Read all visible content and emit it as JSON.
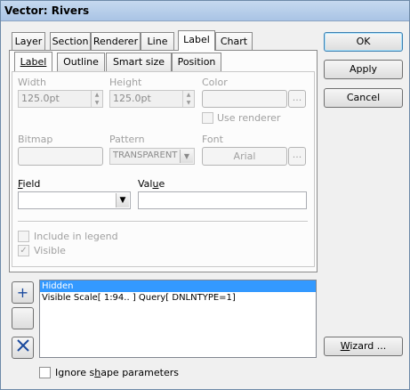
{
  "window": {
    "title": "Vector: Rivers"
  },
  "tabs": [
    "Layer",
    "Section",
    "Renderer",
    "Line",
    "Label",
    "Chart"
  ],
  "active_tab": "Label",
  "subtabs": [
    "Label",
    "Outline",
    "Smart size",
    "Position"
  ],
  "active_subtab": "Label",
  "fields": {
    "width_label": "Width",
    "width_value": "125.0pt",
    "height_label": "Height",
    "height_value": "125.0pt",
    "color_label": "Color",
    "color_btn": "...",
    "use_renderer_label": "Use renderer",
    "bitmap_label": "Bitmap",
    "pattern_label": "Pattern",
    "pattern_value": "TRANSPARENT",
    "font_label": "Font",
    "font_value": "Arial",
    "font_btn": "...",
    "field_label": "Field",
    "field_value": "",
    "value_label": "Value",
    "value_value": "",
    "include_in_legend_label": "Include in legend",
    "visible_label": "Visible"
  },
  "buttons": {
    "ok": "OK",
    "apply": "Apply",
    "cancel": "Cancel",
    "wizard": "Wizard ...",
    "add": "+"
  },
  "rules_list": [
    "Hidden",
    "Visible Scale[ 1:94.. ] Query[ DNLNTYPE=1]"
  ],
  "rules_selected_index": 0,
  "ignore_shape_label": "Ignore shape parameters",
  "states": {
    "use_renderer": false,
    "include_in_legend": false,
    "visible": true,
    "ignore_shape": false
  }
}
